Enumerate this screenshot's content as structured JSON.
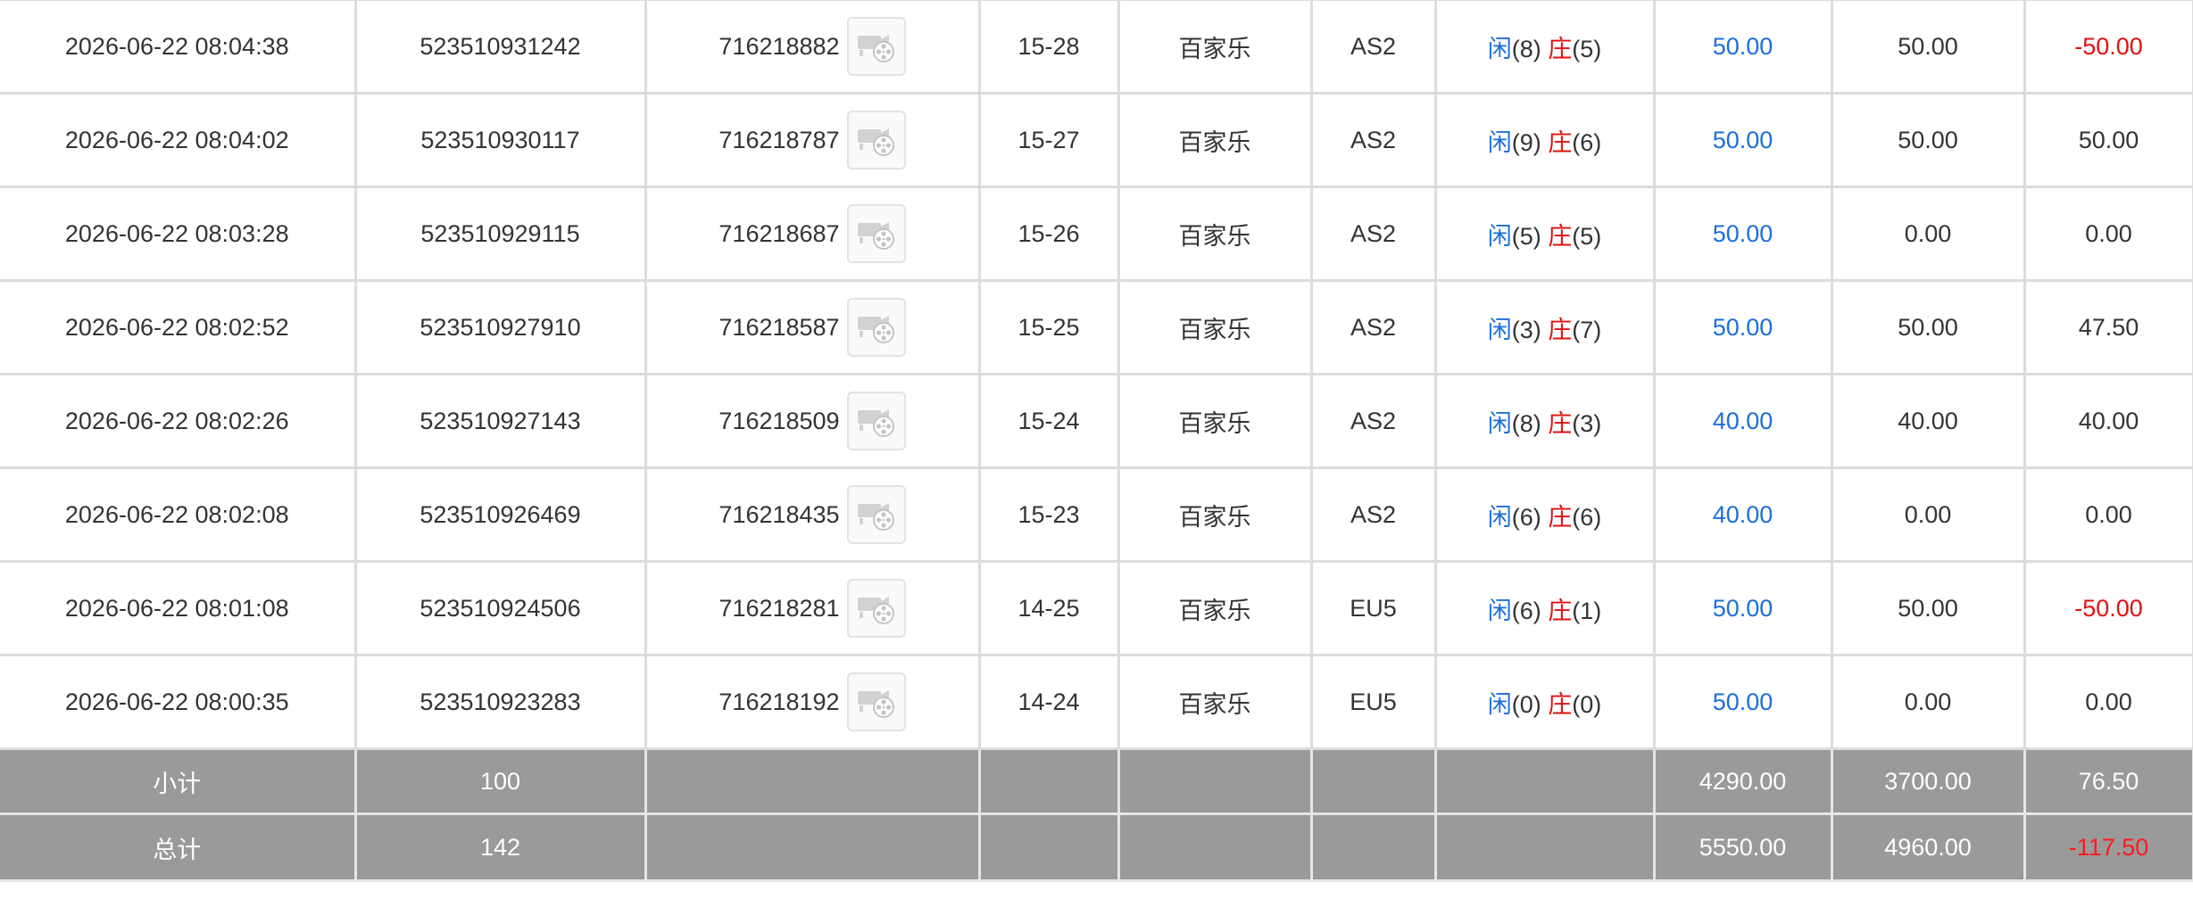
{
  "colors": {
    "player": "#1a6fdc",
    "banker": "#e01010",
    "bet_amount": "#1a6fdc",
    "negative": "#e01010",
    "summary_bg": "#9a9a9a"
  },
  "rows": [
    {
      "time": "2026-06-22 08:04:38",
      "bet_no": "523510931242",
      "round_no": "716218882",
      "shoe": "15-28",
      "game": "百家乐",
      "table": "AS2",
      "player_label": "闲",
      "player_score": "(8)",
      "banker_label": "庄",
      "banker_score": "(5)",
      "bet": "50.00",
      "valid": "50.00",
      "win_loss": "-50.00",
      "negative": true
    },
    {
      "time": "2026-06-22 08:04:02",
      "bet_no": "523510930117",
      "round_no": "716218787",
      "shoe": "15-27",
      "game": "百家乐",
      "table": "AS2",
      "player_label": "闲",
      "player_score": "(9)",
      "banker_label": "庄",
      "banker_score": "(6)",
      "bet": "50.00",
      "valid": "50.00",
      "win_loss": "50.00",
      "negative": false
    },
    {
      "time": "2026-06-22 08:03:28",
      "bet_no": "523510929115",
      "round_no": "716218687",
      "shoe": "15-26",
      "game": "百家乐",
      "table": "AS2",
      "player_label": "闲",
      "player_score": "(5)",
      "banker_label": "庄",
      "banker_score": "(5)",
      "bet": "50.00",
      "valid": "0.00",
      "win_loss": "0.00",
      "negative": false
    },
    {
      "time": "2026-06-22 08:02:52",
      "bet_no": "523510927910",
      "round_no": "716218587",
      "shoe": "15-25",
      "game": "百家乐",
      "table": "AS2",
      "player_label": "闲",
      "player_score": "(3)",
      "banker_label": "庄",
      "banker_score": "(7)",
      "bet": "50.00",
      "valid": "50.00",
      "win_loss": "47.50",
      "negative": false
    },
    {
      "time": "2026-06-22 08:02:26",
      "bet_no": "523510927143",
      "round_no": "716218509",
      "shoe": "15-24",
      "game": "百家乐",
      "table": "AS2",
      "player_label": "闲",
      "player_score": "(8)",
      "banker_label": "庄",
      "banker_score": "(3)",
      "bet": "40.00",
      "valid": "40.00",
      "win_loss": "40.00",
      "negative": false
    },
    {
      "time": "2026-06-22 08:02:08",
      "bet_no": "523510926469",
      "round_no": "716218435",
      "shoe": "15-23",
      "game": "百家乐",
      "table": "AS2",
      "player_label": "闲",
      "player_score": "(6)",
      "banker_label": "庄",
      "banker_score": "(6)",
      "bet": "40.00",
      "valid": "0.00",
      "win_loss": "0.00",
      "negative": false
    },
    {
      "time": "2026-06-22 08:01:08",
      "bet_no": "523510924506",
      "round_no": "716218281",
      "shoe": "14-25",
      "game": "百家乐",
      "table": "EU5",
      "player_label": "闲",
      "player_score": "(6)",
      "banker_label": "庄",
      "banker_score": "(1)",
      "bet": "50.00",
      "valid": "50.00",
      "win_loss": "-50.00",
      "negative": true
    },
    {
      "time": "2026-06-22 08:00:35",
      "bet_no": "523510923283",
      "round_no": "716218192",
      "shoe": "14-24",
      "game": "百家乐",
      "table": "EU5",
      "player_label": "闲",
      "player_score": "(0)",
      "banker_label": "庄",
      "banker_score": "(0)",
      "bet": "50.00",
      "valid": "0.00",
      "win_loss": "0.00",
      "negative": false
    }
  ],
  "subtotal": {
    "label": "小计",
    "count": "100",
    "bet": "4290.00",
    "valid": "3700.00",
    "win_loss": "76.50",
    "negative": false
  },
  "total": {
    "label": "总计",
    "count": "142",
    "bet": "5550.00",
    "valid": "4960.00",
    "win_loss": "-117.50",
    "negative": true
  },
  "icons": {
    "replay": "video-replay-icon"
  }
}
